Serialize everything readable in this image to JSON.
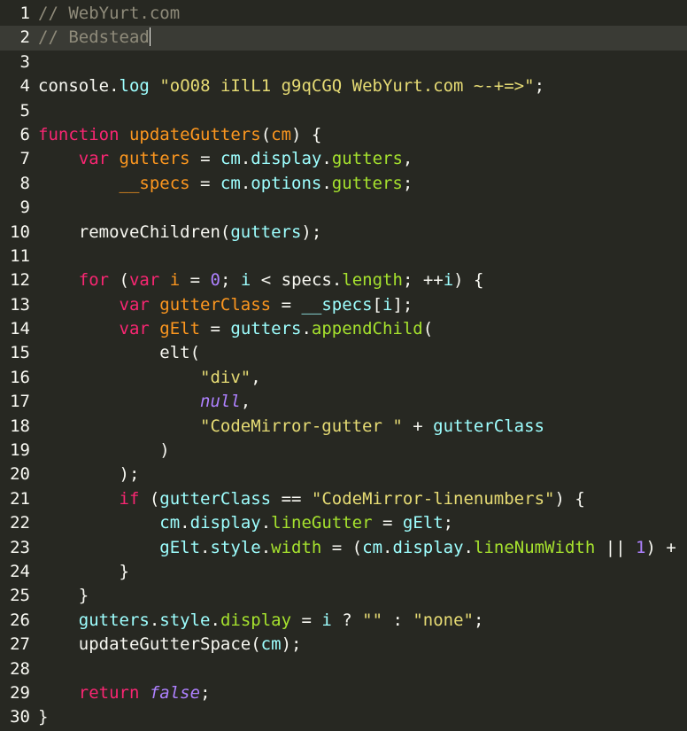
{
  "colors": {
    "background": "#272822",
    "active_line": "#3a3b35",
    "text": "#f8f8f2",
    "comment": "#8f8b7a",
    "keyword": "#f92672",
    "def": "#fd971f",
    "variable": "#a6e22e",
    "string": "#e6db74",
    "number": "#ae81ff",
    "variable2": "#9effff"
  },
  "editor": {
    "active_line": 2,
    "lines": [
      {
        "n": "1",
        "tokens": [
          {
            "t": "// WebYurt.com",
            "c": "comment"
          }
        ]
      },
      {
        "n": "2",
        "tokens": [
          {
            "t": "// Bedstead",
            "c": "comment"
          }
        ],
        "cursor": true
      },
      {
        "n": "3",
        "tokens": []
      },
      {
        "n": "4",
        "tokens": [
          {
            "t": "console",
            "c": "plain"
          },
          {
            "t": ".",
            "c": "punct"
          },
          {
            "t": "log",
            "c": "var2"
          },
          {
            "t": " ",
            "c": "plain"
          },
          {
            "t": "\"oO08 iIlL1 g9qCGQ WebYurt.com ~-+=>\"",
            "c": "string"
          },
          {
            "t": ";",
            "c": "punct"
          }
        ]
      },
      {
        "n": "5",
        "tokens": []
      },
      {
        "n": "6",
        "tokens": [
          {
            "t": "function",
            "c": "keyword"
          },
          {
            "t": " ",
            "c": "plain"
          },
          {
            "t": "updateGutters",
            "c": "def"
          },
          {
            "t": "(",
            "c": "punct"
          },
          {
            "t": "cm",
            "c": "def"
          },
          {
            "t": ") {",
            "c": "punct"
          }
        ]
      },
      {
        "n": "7",
        "tokens": [
          {
            "t": "    ",
            "c": "plain"
          },
          {
            "t": "var",
            "c": "keyword"
          },
          {
            "t": " ",
            "c": "plain"
          },
          {
            "t": "gutters",
            "c": "def"
          },
          {
            "t": " = ",
            "c": "punct"
          },
          {
            "t": "cm",
            "c": "var2"
          },
          {
            "t": ".",
            "c": "punct"
          },
          {
            "t": "display",
            "c": "var2"
          },
          {
            "t": ".",
            "c": "punct"
          },
          {
            "t": "gutters",
            "c": "prop"
          },
          {
            "t": ",",
            "c": "punct"
          }
        ]
      },
      {
        "n": "8",
        "tokens": [
          {
            "t": "        ",
            "c": "plain"
          },
          {
            "t": "__specs",
            "c": "def"
          },
          {
            "t": " = ",
            "c": "punct"
          },
          {
            "t": "cm",
            "c": "var2"
          },
          {
            "t": ".",
            "c": "punct"
          },
          {
            "t": "options",
            "c": "var2"
          },
          {
            "t": ".",
            "c": "punct"
          },
          {
            "t": "gutters",
            "c": "prop"
          },
          {
            "t": ";",
            "c": "punct"
          }
        ]
      },
      {
        "n": "9",
        "tokens": []
      },
      {
        "n": "10",
        "tokens": [
          {
            "t": "    removeChildren(",
            "c": "plain"
          },
          {
            "t": "gutters",
            "c": "var2"
          },
          {
            "t": ");",
            "c": "punct"
          }
        ]
      },
      {
        "n": "11",
        "tokens": []
      },
      {
        "n": "12",
        "tokens": [
          {
            "t": "    ",
            "c": "plain"
          },
          {
            "t": "for",
            "c": "keyword"
          },
          {
            "t": " (",
            "c": "punct"
          },
          {
            "t": "var",
            "c": "keyword"
          },
          {
            "t": " ",
            "c": "plain"
          },
          {
            "t": "i",
            "c": "def"
          },
          {
            "t": " = ",
            "c": "punct"
          },
          {
            "t": "0",
            "c": "number"
          },
          {
            "t": "; ",
            "c": "punct"
          },
          {
            "t": "i",
            "c": "var2"
          },
          {
            "t": " < specs.",
            "c": "plain"
          },
          {
            "t": "length",
            "c": "prop"
          },
          {
            "t": "; ++",
            "c": "punct"
          },
          {
            "t": "i",
            "c": "var2"
          },
          {
            "t": ") {",
            "c": "punct"
          }
        ]
      },
      {
        "n": "13",
        "tokens": [
          {
            "t": "        ",
            "c": "plain"
          },
          {
            "t": "var",
            "c": "keyword"
          },
          {
            "t": " ",
            "c": "plain"
          },
          {
            "t": "gutterClass",
            "c": "def"
          },
          {
            "t": " = ",
            "c": "punct"
          },
          {
            "t": "__specs",
            "c": "var2"
          },
          {
            "t": "[",
            "c": "punct"
          },
          {
            "t": "i",
            "c": "var2"
          },
          {
            "t": "];",
            "c": "punct"
          }
        ]
      },
      {
        "n": "14",
        "tokens": [
          {
            "t": "        ",
            "c": "plain"
          },
          {
            "t": "var",
            "c": "keyword"
          },
          {
            "t": " ",
            "c": "plain"
          },
          {
            "t": "gElt",
            "c": "def"
          },
          {
            "t": " = ",
            "c": "punct"
          },
          {
            "t": "gutters",
            "c": "var2"
          },
          {
            "t": ".",
            "c": "punct"
          },
          {
            "t": "appendChild",
            "c": "prop"
          },
          {
            "t": "(",
            "c": "punct"
          }
        ]
      },
      {
        "n": "15",
        "tokens": [
          {
            "t": "            elt(",
            "c": "plain"
          }
        ]
      },
      {
        "n": "16",
        "tokens": [
          {
            "t": "                ",
            "c": "plain"
          },
          {
            "t": "\"div\"",
            "c": "string"
          },
          {
            "t": ",",
            "c": "punct"
          }
        ]
      },
      {
        "n": "17",
        "tokens": [
          {
            "t": "                ",
            "c": "plain"
          },
          {
            "t": "null",
            "c": "atom"
          },
          {
            "t": ",",
            "c": "punct"
          }
        ]
      },
      {
        "n": "18",
        "tokens": [
          {
            "t": "                ",
            "c": "plain"
          },
          {
            "t": "\"CodeMirror-gutter \"",
            "c": "string"
          },
          {
            "t": " + ",
            "c": "punct"
          },
          {
            "t": "gutterClass",
            "c": "var2"
          }
        ]
      },
      {
        "n": "19",
        "tokens": [
          {
            "t": "            )",
            "c": "plain"
          }
        ]
      },
      {
        "n": "20",
        "tokens": [
          {
            "t": "        );",
            "c": "plain"
          }
        ]
      },
      {
        "n": "21",
        "tokens": [
          {
            "t": "        ",
            "c": "plain"
          },
          {
            "t": "if",
            "c": "keyword"
          },
          {
            "t": " (",
            "c": "punct"
          },
          {
            "t": "gutterClass",
            "c": "var2"
          },
          {
            "t": " == ",
            "c": "punct"
          },
          {
            "t": "\"CodeMirror-linenumbers\"",
            "c": "string"
          },
          {
            "t": ") {",
            "c": "punct"
          }
        ]
      },
      {
        "n": "22",
        "tokens": [
          {
            "t": "            ",
            "c": "plain"
          },
          {
            "t": "cm",
            "c": "var2"
          },
          {
            "t": ".",
            "c": "punct"
          },
          {
            "t": "display",
            "c": "var2"
          },
          {
            "t": ".",
            "c": "punct"
          },
          {
            "t": "lineGutter",
            "c": "prop"
          },
          {
            "t": " = ",
            "c": "punct"
          },
          {
            "t": "gElt",
            "c": "var2"
          },
          {
            "t": ";",
            "c": "punct"
          }
        ]
      },
      {
        "n": "23",
        "tokens": [
          {
            "t": "            ",
            "c": "plain"
          },
          {
            "t": "gElt",
            "c": "var2"
          },
          {
            "t": ".",
            "c": "punct"
          },
          {
            "t": "style",
            "c": "var2"
          },
          {
            "t": ".",
            "c": "punct"
          },
          {
            "t": "width",
            "c": "prop"
          },
          {
            "t": " = (",
            "c": "punct"
          },
          {
            "t": "cm",
            "c": "var2"
          },
          {
            "t": ".",
            "c": "punct"
          },
          {
            "t": "display",
            "c": "var2"
          },
          {
            "t": ".",
            "c": "punct"
          },
          {
            "t": "lineNumWidth",
            "c": "prop"
          },
          {
            "t": " || ",
            "c": "punct"
          },
          {
            "t": "1",
            "c": "number"
          },
          {
            "t": ") + ",
            "c": "punct"
          }
        ]
      },
      {
        "n": "24",
        "tokens": [
          {
            "t": "        }",
            "c": "plain"
          }
        ]
      },
      {
        "n": "25",
        "tokens": [
          {
            "t": "    }",
            "c": "plain"
          }
        ]
      },
      {
        "n": "26",
        "tokens": [
          {
            "t": "    ",
            "c": "plain"
          },
          {
            "t": "gutters",
            "c": "var2"
          },
          {
            "t": ".",
            "c": "punct"
          },
          {
            "t": "style",
            "c": "var2"
          },
          {
            "t": ".",
            "c": "punct"
          },
          {
            "t": "display",
            "c": "prop"
          },
          {
            "t": " = ",
            "c": "punct"
          },
          {
            "t": "i",
            "c": "var2"
          },
          {
            "t": " ? ",
            "c": "punct"
          },
          {
            "t": "\"\"",
            "c": "string"
          },
          {
            "t": " : ",
            "c": "punct"
          },
          {
            "t": "\"none\"",
            "c": "string"
          },
          {
            "t": ";",
            "c": "punct"
          }
        ]
      },
      {
        "n": "27",
        "tokens": [
          {
            "t": "    updateGutterSpace(",
            "c": "plain"
          },
          {
            "t": "cm",
            "c": "var2"
          },
          {
            "t": ");",
            "c": "punct"
          }
        ]
      },
      {
        "n": "28",
        "tokens": []
      },
      {
        "n": "29",
        "tokens": [
          {
            "t": "    ",
            "c": "plain"
          },
          {
            "t": "return",
            "c": "keyword"
          },
          {
            "t": " ",
            "c": "plain"
          },
          {
            "t": "false",
            "c": "atom"
          },
          {
            "t": ";",
            "c": "punct"
          }
        ]
      },
      {
        "n": "30",
        "tokens": [
          {
            "t": "}",
            "c": "plain"
          }
        ]
      }
    ]
  }
}
